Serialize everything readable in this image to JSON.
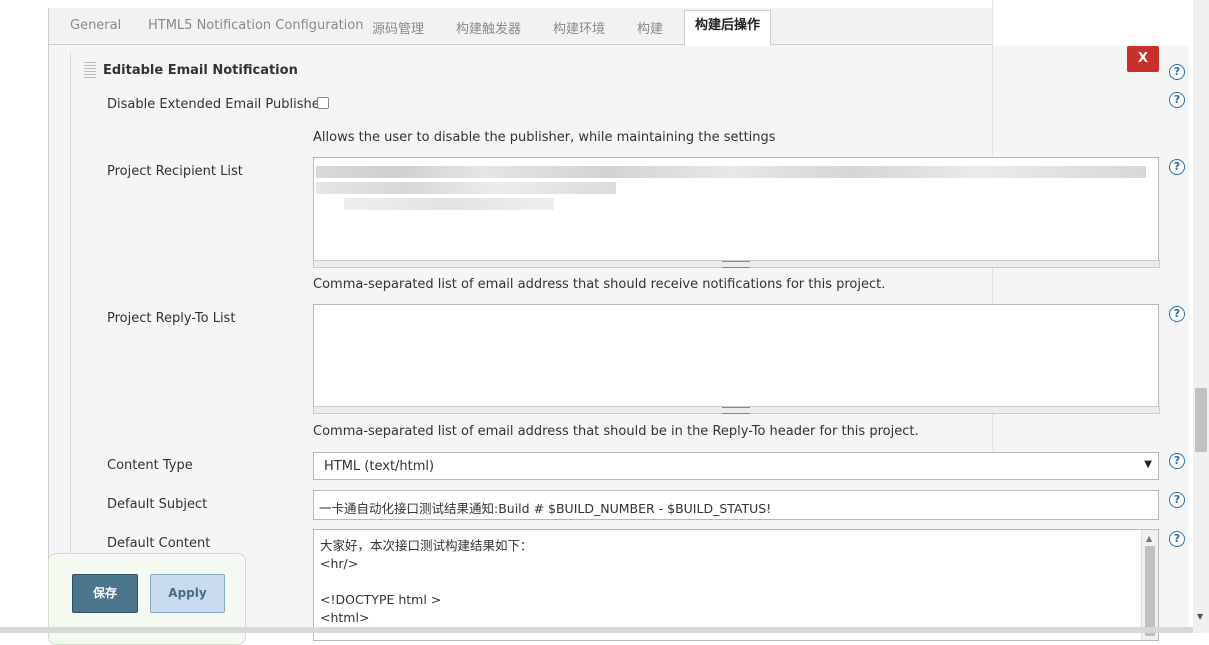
{
  "tabs": [
    {
      "label": "General"
    },
    {
      "label": "HTML5 Notification Configuration"
    },
    {
      "label": "源码管理"
    },
    {
      "label": "构建触发器"
    },
    {
      "label": "构建环境"
    },
    {
      "label": "构建"
    },
    {
      "label": "构建后操作"
    }
  ],
  "section": {
    "title": "Editable Email Notification",
    "close_label": "X"
  },
  "fields": {
    "disable_label": "Disable Extended Email Publisher",
    "disable_help": "Allows the user to disable the publisher, while maintaining the settings",
    "recipient_label": "Project Recipient List",
    "recipient_help": "Comma-separated list of email address that should receive notifications for this project.",
    "replyto_label": "Project Reply-To List",
    "replyto_help": "Comma-separated list of email address that should be in the Reply-To header for this project.",
    "content_type_label": "Content Type",
    "content_type_value": "HTML (text/html)",
    "subject_label": "Default Subject",
    "subject_value": "一卡通自动化接口测试结果通知:Build # $BUILD_NUMBER - $BUILD_STATUS!",
    "content_label": "Default Content",
    "content_lines": [
      "大家好，本次接口测试构建结果如下：",
      "<hr/>",
      "",
      "<!DOCTYPE html >",
      "<html>"
    ]
  },
  "buttons": {
    "save": "保存",
    "apply": "Apply"
  },
  "help_glyph": "?",
  "colors": {
    "close_red": "#c9302c",
    "save_bg": "#4b758b",
    "apply_bg": "#c9dcef",
    "help_blue": "#2f6ea8"
  }
}
